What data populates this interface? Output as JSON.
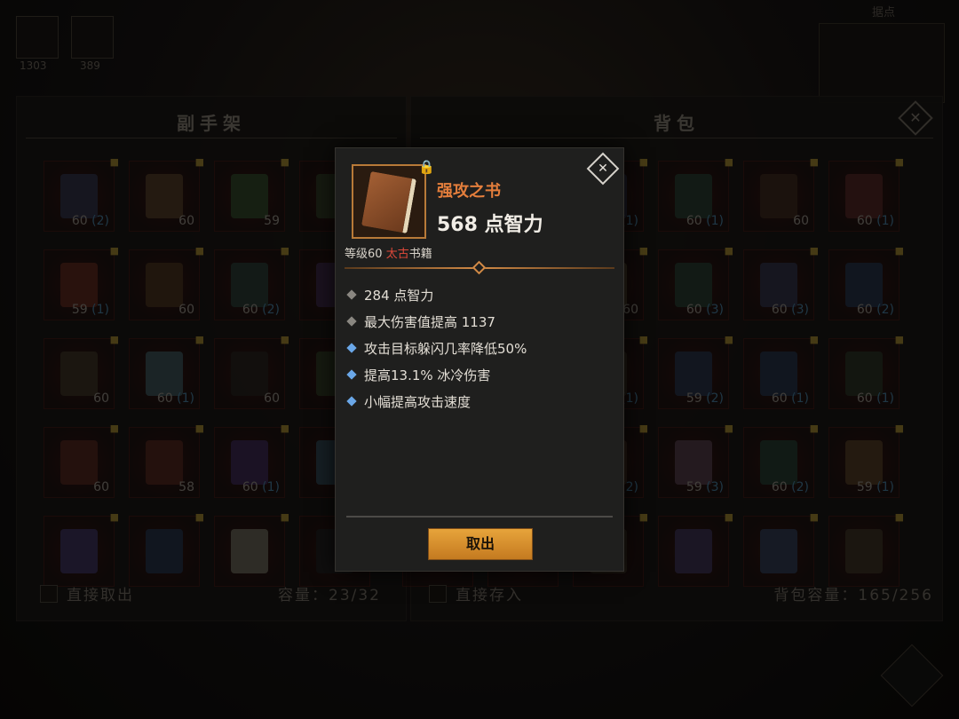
{
  "hud": {
    "resource_a": "1303",
    "resource_b": "389",
    "map_title": "据点"
  },
  "left_panel": {
    "title": "副手架",
    "footer_action": "直接取出",
    "capacity": "容量：23/32",
    "slots": [
      {
        "lvl": "60",
        "extra": "(2)",
        "color": "#3b3a5a"
      },
      {
        "lvl": "60",
        "extra": "",
        "color": "#6a4a2c"
      },
      {
        "lvl": "59",
        "extra": "",
        "color": "#3a5a30"
      },
      {
        "lvl": "",
        "extra": "",
        "color": "#3a4a2a"
      },
      {
        "lvl": "59",
        "extra": "(1)",
        "color": "#7a3020"
      },
      {
        "lvl": "60",
        "extra": "",
        "color": "#5a3a1e"
      },
      {
        "lvl": "60",
        "extra": "(2)",
        "color": "#2f4a40"
      },
      {
        "lvl": "",
        "extra": "",
        "color": "#4a2f5a"
      },
      {
        "lvl": "60",
        "extra": "",
        "color": "#4a3a2a"
      },
      {
        "lvl": "60",
        "extra": "(1)",
        "color": "#4a6a70"
      },
      {
        "lvl": "60",
        "extra": "",
        "color": "#2a2620"
      },
      {
        "lvl": "",
        "extra": "",
        "color": "#3a4a2a"
      },
      {
        "lvl": "60",
        "extra": "",
        "color": "#6a2a20"
      },
      {
        "lvl": "58",
        "extra": "",
        "color": "#6a2a20"
      },
      {
        "lvl": "60",
        "extra": "(1)",
        "color": "#4a2f6a"
      },
      {
        "lvl": "",
        "extra": "",
        "color": "#3a5a6a"
      },
      {
        "lvl": "",
        "extra": "",
        "color": "#4a3a7a"
      },
      {
        "lvl": "",
        "extra": "",
        "color": "#2a3a5a"
      },
      {
        "lvl": "",
        "extra": "",
        "color": "#8a8470"
      },
      {
        "lvl": "",
        "extra": "",
        "color": "#222"
      }
    ]
  },
  "right_panel": {
    "title": "背包",
    "footer_action": "直接存入",
    "capacity": "背包容量：165/256",
    "slots": [
      {
        "lvl": "60",
        "extra": "(1)",
        "color": "#3a3a5a"
      },
      {
        "lvl": "60",
        "extra": "(1)",
        "color": "#2a4a3a"
      },
      {
        "lvl": "60",
        "extra": "",
        "color": "#4a2f1e"
      },
      {
        "lvl": "60",
        "extra": "(1)",
        "color": "#6a2a2a"
      },
      {
        "lvl": "60",
        "extra": "",
        "color": "#6a5a3a"
      },
      {
        "lvl": "60",
        "extra": "(3)",
        "color": "#2a4a3a"
      },
      {
        "lvl": "60",
        "extra": "(3)",
        "color": "#3a3a5a"
      },
      {
        "lvl": "60",
        "extra": "(2)",
        "color": "#2a3a5a"
      },
      {
        "lvl": "60",
        "extra": "(1)",
        "color": "#4a3a2a"
      },
      {
        "lvl": "59",
        "extra": "(2)",
        "color": "#2a3a5a"
      },
      {
        "lvl": "60",
        "extra": "(1)",
        "color": "#2a3a5a"
      },
      {
        "lvl": "60",
        "extra": "(1)",
        "color": "#2f3a2a"
      },
      {
        "lvl": "60",
        "extra": "(2)",
        "color": "#5a3a2a"
      },
      {
        "lvl": "59",
        "extra": "(3)",
        "color": "#6a4a5a"
      },
      {
        "lvl": "60",
        "extra": "(2)",
        "color": "#2a4a3a"
      },
      {
        "lvl": "59",
        "extra": "(1)",
        "color": "#6a4a2a"
      },
      {
        "lvl": "",
        "extra": "",
        "color": "#4a3a2a"
      },
      {
        "lvl": "",
        "extra": "",
        "color": "#4a3a6a"
      },
      {
        "lvl": "",
        "extra": "",
        "color": "#3a4a6a"
      },
      {
        "lvl": "",
        "extra": "",
        "color": "#4a3a2a"
      }
    ]
  },
  "tooltip": {
    "name": "强攻之书",
    "main_stat": "568 点智力",
    "meta_prefix": "等级60 ",
    "meta_rarity": "太古",
    "meta_type": "书籍",
    "stats": [
      {
        "text": "284 点智力",
        "kind": "primary"
      },
      {
        "text": "最大伤害值提高 1137",
        "kind": "primary"
      },
      {
        "text": "攻击目标躲闪几率降低50%",
        "kind": "secondary"
      },
      {
        "text": "提高13.1% 冰冷伤害",
        "kind": "secondary"
      },
      {
        "text": "小幅提高攻击速度",
        "kind": "secondary"
      }
    ],
    "action_label": "取出",
    "close_glyph": "✕",
    "lock_glyph": "🔒"
  },
  "colors": {
    "primary_bullet": "#8a8781",
    "secondary_bullet": "#6aa7e8",
    "legendary": "#e47e3c",
    "ancient": "#e0493a"
  }
}
